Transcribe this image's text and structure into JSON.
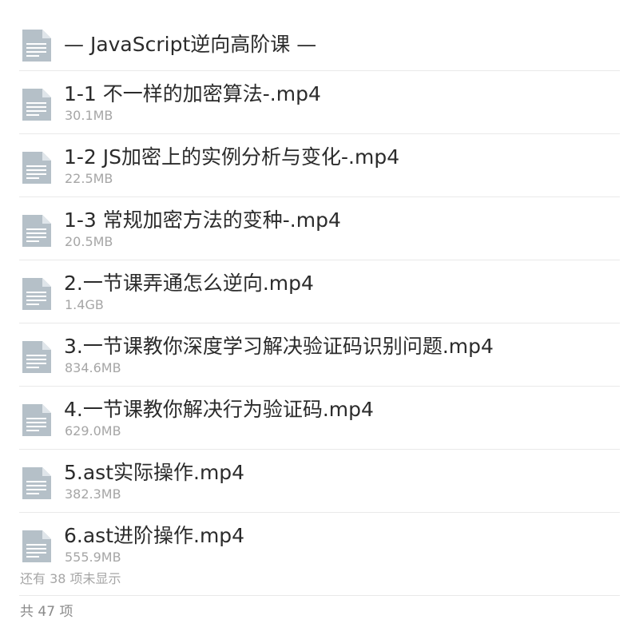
{
  "folder": {
    "title": "— JavaScript逆向高阶课 —",
    "icon": "document-icon"
  },
  "files": [
    {
      "name": "1-1 不一样的加密算法-.mp4",
      "size": "30.1MB",
      "icon": "document-icon"
    },
    {
      "name": "1-2 JS加密上的实例分析与变化-.mp4",
      "size": "22.5MB",
      "icon": "document-icon"
    },
    {
      "name": "1-3 常规加密方法的变种-.mp4",
      "size": "20.5MB",
      "icon": "document-icon"
    },
    {
      "name": "2.一节课弄通怎么逆向.mp4",
      "size": "1.4GB",
      "icon": "document-icon"
    },
    {
      "name": "3.一节课教你深度学习解决验证码识别问题.mp4",
      "size": "834.6MB",
      "icon": "document-icon"
    },
    {
      "name": "4.一节课教你解决行为验证码.mp4",
      "size": "629.0MB",
      "icon": "document-icon"
    },
    {
      "name": "5.ast实际操作.mp4",
      "size": "382.3MB",
      "icon": "document-icon"
    },
    {
      "name": "6.ast进阶操作.mp4",
      "size": "555.9MB",
      "icon": "document-icon"
    }
  ],
  "footer": {
    "hidden_note": "还有 38 项未显示",
    "total": "共 47 项"
  },
  "colors": {
    "icon": "#b5c0c8",
    "icon_lines": "#ffffff",
    "title_text": "#2b2b2b",
    "meta_text": "#a6a6a6",
    "divider": "#e9e9e9"
  }
}
